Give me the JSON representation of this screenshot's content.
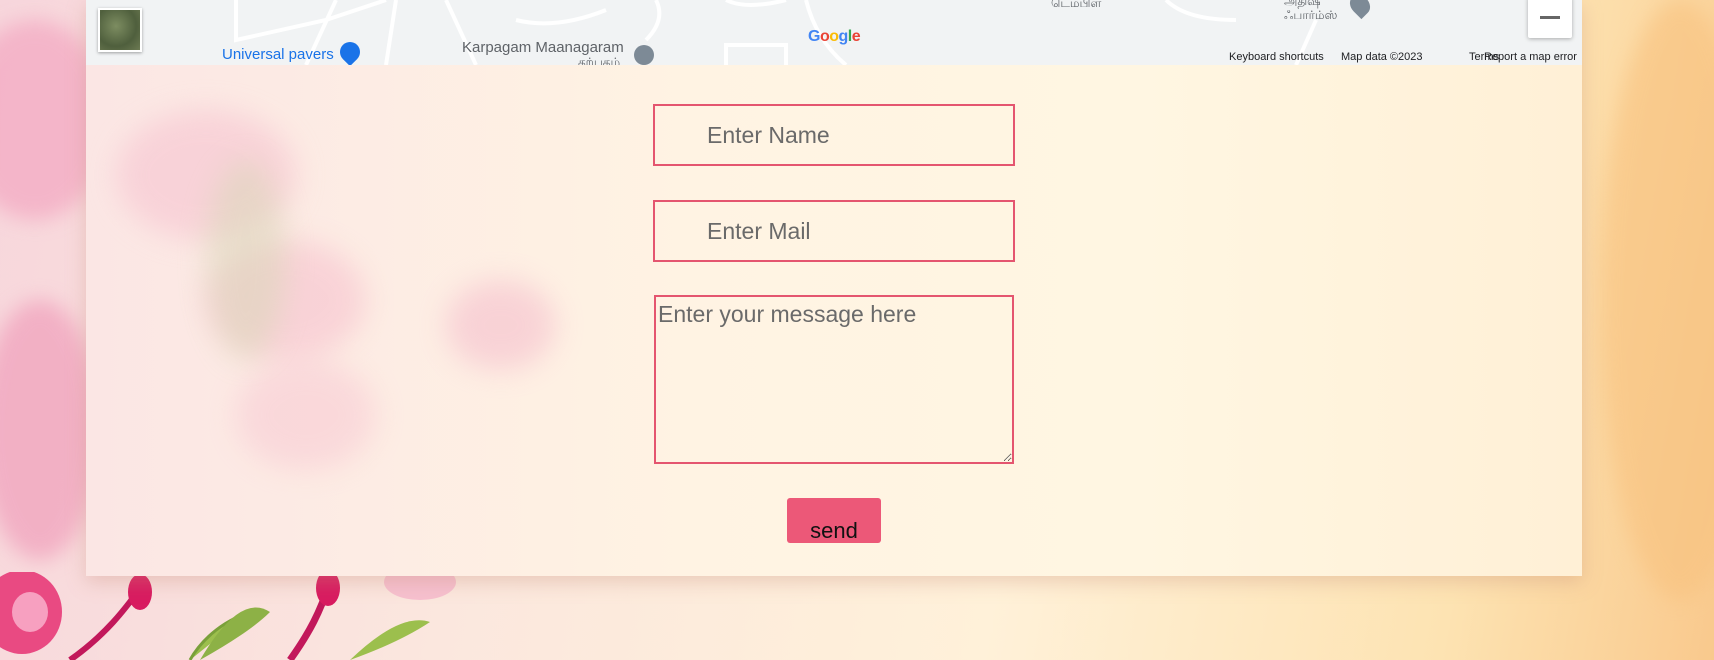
{
  "map": {
    "labels": {
      "universal_pavers": "Universal pavers",
      "karpagam": "Karpagam Maanagaram",
      "karpagam_ta": "கற்பகம்",
      "temple_ta": "டெம்பிள்",
      "farms_ta_1": "அதிஷ்",
      "farms_ta_2": "ஃபார்ம்ஸ்"
    },
    "google_logo": [
      "G",
      "o",
      "o",
      "g",
      "l",
      "e"
    ],
    "footer": {
      "keyboard_shortcuts": "Keyboard shortcuts",
      "map_data": "Map data ©2023",
      "terms": "Terms",
      "report": "Report a map error"
    },
    "icons": {
      "zoom_out": "minus-icon",
      "layer_toggle": "satellite-thumbnail"
    }
  },
  "form": {
    "name_placeholder": "Enter Name",
    "mail_placeholder": "Enter Mail",
    "message_placeholder": "Enter your message here",
    "send_label": "send"
  },
  "colors": {
    "field_border": "#e4556f",
    "send_button": "#ec5878",
    "map_link": "#1a73e8"
  }
}
